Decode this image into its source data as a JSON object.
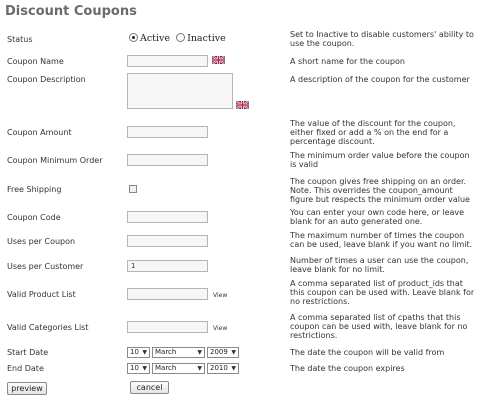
{
  "page_title": "Discount Coupons",
  "fields": {
    "status": {
      "label": "Status",
      "help": "Set to Inactive to disable customers' ability to use the coupon.",
      "options": [
        "Active",
        "Inactive"
      ],
      "selected": "Active"
    },
    "name": {
      "label": "Coupon Name",
      "help": "A short name for the coupon",
      "value": ""
    },
    "description": {
      "label": "Coupon Description",
      "help": "A description of the coupon for the customer",
      "value": ""
    },
    "amount": {
      "label": "Coupon Amount",
      "help": "The value of the discount for the coupon, either fixed or add a % on the end for a percentage discount.",
      "value": ""
    },
    "min_order": {
      "label": "Coupon Minimum Order",
      "help": "The minimum order value before the coupon is valid",
      "value": ""
    },
    "free_shipping": {
      "label": "Free Shipping",
      "help": "The coupon gives free shipping on an order. Note. This overrides the coupon_amount figure but respects the minimum order value",
      "checked": false
    },
    "code": {
      "label": "Coupon Code",
      "help": "You can enter your own code here, or leave blank for an auto generated one.",
      "value": ""
    },
    "uses_per_coupon": {
      "label": "Uses per Coupon",
      "help": "The maximum number of times the coupon can be used, leave blank if you want no limit.",
      "value": ""
    },
    "uses_per_customer": {
      "label": "Uses per Customer",
      "help": "Number of times a user can use the coupon, leave blank for no limit.",
      "value": "1"
    },
    "product_list": {
      "label": "Valid Product List",
      "help": "A comma separated list of product_ids that this coupon can be used with. Leave blank for no restrictions.",
      "value": "",
      "view_label": "View"
    },
    "categories_list": {
      "label": "Valid Categories List",
      "help": "A comma separated list of cpaths that this coupon can be used with, leave blank for no restrictions.",
      "value": "",
      "view_label": "View"
    },
    "start_date": {
      "label": "Start Date",
      "help": "The date the coupon will be valid from",
      "day": "10",
      "month": "March",
      "year": "2009"
    },
    "end_date": {
      "label": "End Date",
      "help": "The date the coupon expires",
      "day": "10",
      "month": "March",
      "year": "2010"
    }
  },
  "buttons": {
    "preview": "preview",
    "cancel": "cancel"
  },
  "icons": {
    "language_flag": "uk-flag-icon",
    "dropdown": "chevron-down-icon"
  }
}
